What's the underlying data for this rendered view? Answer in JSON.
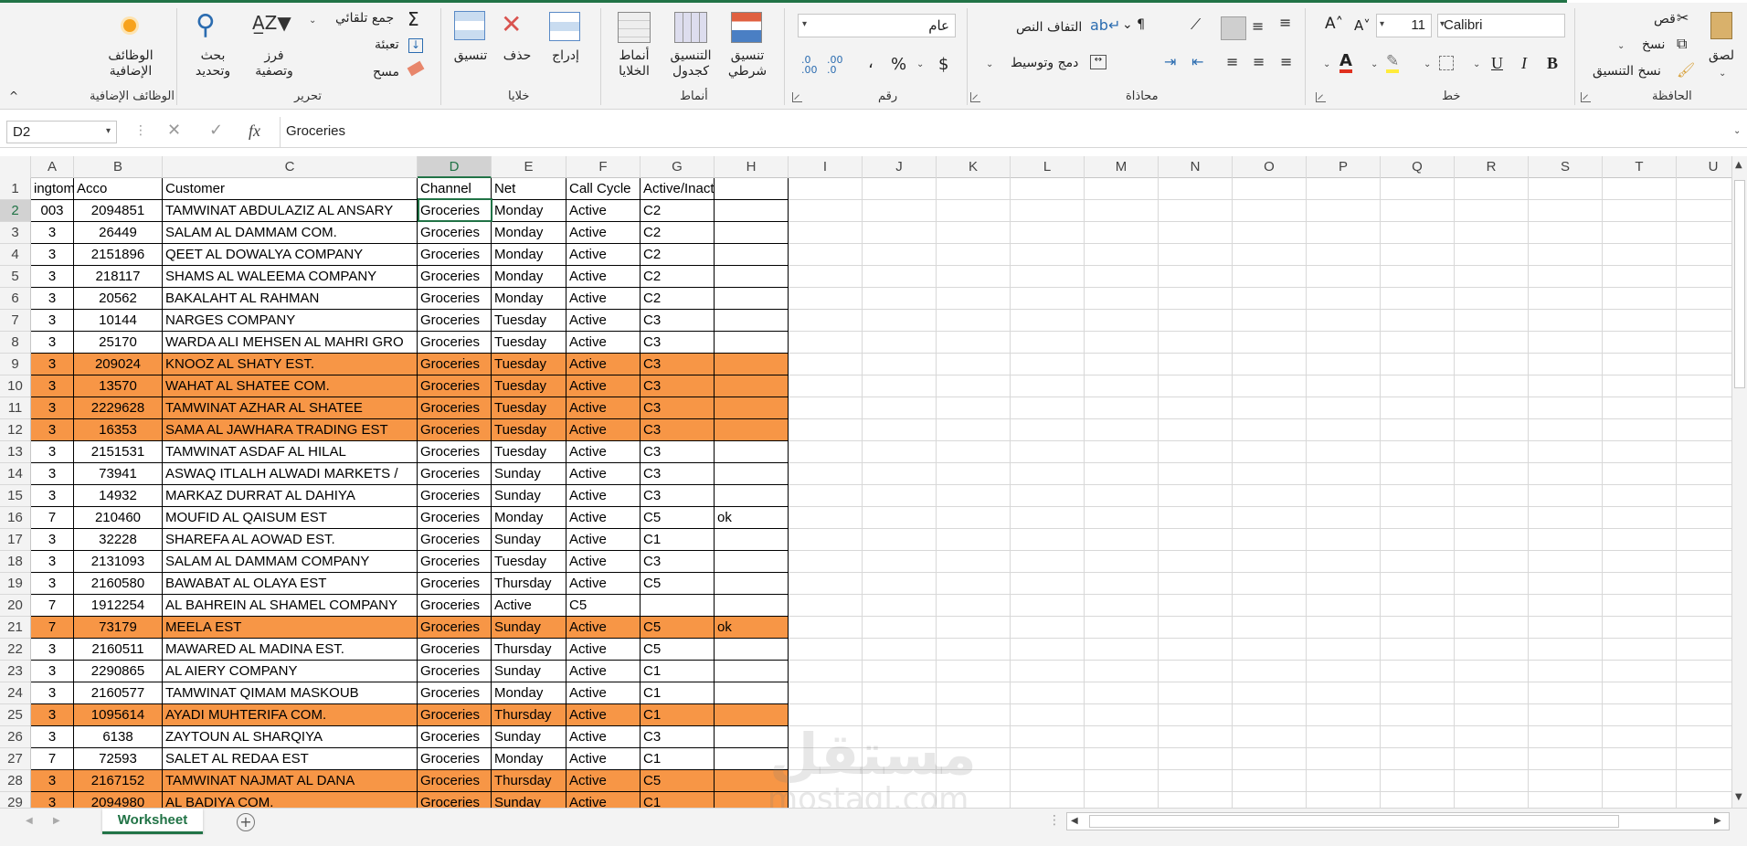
{
  "ribbon": {
    "addins": {
      "label": "الوظائف الإضافية",
      "group": "الوظائف الإضافية"
    },
    "editing": {
      "group": "تحرير",
      "autosum": "جمع تلقائي",
      "fill": "تعبئة",
      "clear": "مسح",
      "sort_filter": "فرز وتصفية",
      "find_select": "بحث وتحديد"
    },
    "cells": {
      "group": "خلايا",
      "format": "تنسيق",
      "delete": "حذف",
      "insert": "إدراج"
    },
    "styles": {
      "group": "أنماط",
      "cell_styles": "أنماط الخلايا",
      "format_table": "التنسيق كجدول",
      "conditional": "تنسيق شرطي"
    },
    "number": {
      "group": "رقم",
      "format_value": "عام",
      "currency": "$",
      "percent": "%",
      "comma": "،",
      "inc_dec": ".00 .0",
      "dec_dec": ".0 .00"
    },
    "alignment": {
      "group": "محاذاة",
      "wrap_text": "التفاف النص",
      "merge_center": "دمج وتوسيط"
    },
    "font": {
      "group": "خط",
      "name": "Calibri",
      "size": "11",
      "bold": "B",
      "italic": "I",
      "underline": "U"
    },
    "clipboard": {
      "group": "الحافظة",
      "paste": "لصق",
      "cut": "قص",
      "copy": "نسخ",
      "format_painter": "نسخ التنسيق"
    }
  },
  "formula_bar": {
    "name_box": "D2",
    "cancel": "✕",
    "enter": "✓",
    "fx": "fx",
    "formula": "Groceries"
  },
  "columns": [
    "A",
    "B",
    "C",
    "D",
    "E",
    "F",
    "G",
    "H",
    "I",
    "J",
    "K",
    "L",
    "M",
    "N",
    "O",
    "P",
    "Q",
    "R",
    "S",
    "T",
    "U"
  ],
  "header_row": {
    "A": "ingtom",
    "B": "Acco",
    "C": "Customer",
    "D": "Channel",
    "E": "Net",
    "F": "Call Cycle",
    "G": "Active/Inactive",
    "H": ""
  },
  "rows": [
    {
      "n": "2",
      "a": "003",
      "b": "2094851",
      "c": "TAMWINAT ABDULAZIZ AL ANSARY",
      "d": "Groceries",
      "e": "Monday",
      "f": "Active",
      "g": "C2",
      "h": "",
      "hl": false
    },
    {
      "n": "3",
      "a": "3",
      "b": "26449",
      "c": "SALAM AL DAMMAM COM.",
      "d": "Groceries",
      "e": "Monday",
      "f": "Active",
      "g": "C2",
      "h": "",
      "hl": false
    },
    {
      "n": "4",
      "a": "3",
      "b": "2151896",
      "c": "QEET AL DOWALYA COMPANY",
      "d": "Groceries",
      "e": "Monday",
      "f": "Active",
      "g": "C2",
      "h": "",
      "hl": false
    },
    {
      "n": "5",
      "a": "3",
      "b": "218117",
      "c": "SHAMS AL WALEEMA COMPANY",
      "d": "Groceries",
      "e": "Monday",
      "f": "Active",
      "g": "C2",
      "h": "",
      "hl": false
    },
    {
      "n": "6",
      "a": "3",
      "b": "20562",
      "c": "BAKALAHT AL RAHMAN",
      "d": "Groceries",
      "e": "Monday",
      "f": "Active",
      "g": "C2",
      "h": "",
      "hl": false
    },
    {
      "n": "7",
      "a": "3",
      "b": "10144",
      "c": "NARGES COMPANY",
      "d": "Groceries",
      "e": "Tuesday",
      "f": "Active",
      "g": "C3",
      "h": "",
      "hl": false
    },
    {
      "n": "8",
      "a": "3",
      "b": "25170",
      "c": "WARDA ALI MEHSEN AL MAHRI GRO",
      "d": "Groceries",
      "e": "Tuesday",
      "f": "Active",
      "g": "C3",
      "h": "",
      "hl": false
    },
    {
      "n": "9",
      "a": "3",
      "b": "209024",
      "c": "KNOOZ AL SHATY EST.",
      "d": "Groceries",
      "e": "Tuesday",
      "f": "Active",
      "g": "C3",
      "h": "",
      "hl": true
    },
    {
      "n": "10",
      "a": "3",
      "b": "13570",
      "c": "WAHAT AL SHATEE COM.",
      "d": "Groceries",
      "e": "Tuesday",
      "f": "Active",
      "g": "C3",
      "h": "",
      "hl": true
    },
    {
      "n": "11",
      "a": "3",
      "b": "2229628",
      "c": "TAMWINAT AZHAR AL SHATEE",
      "d": "Groceries",
      "e": "Tuesday",
      "f": "Active",
      "g": "C3",
      "h": "",
      "hl": true
    },
    {
      "n": "12",
      "a": "3",
      "b": "16353",
      "c": "SAMA AL JAWHARA TRADING EST",
      "d": "Groceries",
      "e": "Tuesday",
      "f": "Active",
      "g": "C3",
      "h": "",
      "hl": true
    },
    {
      "n": "13",
      "a": "3",
      "b": "2151531",
      "c": "TAMWINAT ASDAF AL HILAL",
      "d": "Groceries",
      "e": "Tuesday",
      "f": "Active",
      "g": "C3",
      "h": "",
      "hl": false
    },
    {
      "n": "14",
      "a": "3",
      "b": "73941",
      "c": "ASWAQ ITLALH ALWADI MARKETS /",
      "d": "Groceries",
      "e": "Sunday",
      "f": "Active",
      "g": "C3",
      "h": "",
      "hl": false
    },
    {
      "n": "15",
      "a": "3",
      "b": "14932",
      "c": "MARKAZ DURRAT AL DAHIYA",
      "d": "Groceries",
      "e": "Sunday",
      "f": "Active",
      "g": "C3",
      "h": "",
      "hl": false
    },
    {
      "n": "16",
      "a": "7",
      "b": "210460",
      "c": "MOUFID AL QAISUM EST",
      "d": "Groceries",
      "e": "Monday",
      "f": "Active",
      "g": "C5",
      "h": "ok",
      "hl": false
    },
    {
      "n": "17",
      "a": "3",
      "b": "32228",
      "c": "SHAREFA AL AOWAD EST.",
      "d": "Groceries",
      "e": "Sunday",
      "f": "Active",
      "g": "C1",
      "h": "",
      "hl": false
    },
    {
      "n": "18",
      "a": "3",
      "b": "2131093",
      "c": "SALAM AL DAMMAM COMPANY",
      "d": "Groceries",
      "e": "Tuesday",
      "f": "Active",
      "g": "C3",
      "h": "",
      "hl": false
    },
    {
      "n": "19",
      "a": "3",
      "b": "2160580",
      "c": "BAWABAT AL OLAYA EST",
      "d": "Groceries",
      "e": "Thursday",
      "f": "Active",
      "g": "C5",
      "h": "",
      "hl": false
    },
    {
      "n": "20",
      "a": "7",
      "b": "1912254",
      "c": "AL BAHREIN AL SHAMEL COMPANY",
      "d": "Groceries",
      "e": "Active",
      "f": "C5",
      "g": "",
      "h": "",
      "hl": false
    },
    {
      "n": "21",
      "a": "7",
      "b": "73179",
      "c": "MEELA EST",
      "d": "Groceries",
      "e": "Sunday",
      "f": "Active",
      "g": "C5",
      "h": "ok",
      "hl": true
    },
    {
      "n": "22",
      "a": "3",
      "b": "2160511",
      "c": "MAWARED AL MADINA EST.",
      "d": "Groceries",
      "e": "Thursday",
      "f": "Active",
      "g": "C5",
      "h": "",
      "hl": false
    },
    {
      "n": "23",
      "a": "3",
      "b": "2290865",
      "c": "AL AIERY COMPANY",
      "d": "Groceries",
      "e": "Sunday",
      "f": "Active",
      "g": "C1",
      "h": "",
      "hl": false
    },
    {
      "n": "24",
      "a": "3",
      "b": "2160577",
      "c": "TAMWINAT QIMAM MASKOUB",
      "d": "Groceries",
      "e": "Monday",
      "f": "Active",
      "g": "C1",
      "h": "",
      "hl": false
    },
    {
      "n": "25",
      "a": "3",
      "b": "1095614",
      "c": "AYADI MUHTERIFA COM.",
      "d": "Groceries",
      "e": "Thursday",
      "f": "Active",
      "g": "C1",
      "h": "",
      "hl": true
    },
    {
      "n": "26",
      "a": "3",
      "b": "6138",
      "c": "ZAYTOUN AL SHARQIYA",
      "d": "Groceries",
      "e": "Sunday",
      "f": "Active",
      "g": "C3",
      "h": "",
      "hl": false
    },
    {
      "n": "27",
      "a": "7",
      "b": "72593",
      "c": "SALET AL REDAA EST",
      "d": "Groceries",
      "e": "Monday",
      "f": "Active",
      "g": "C1",
      "h": "",
      "hl": false
    },
    {
      "n": "28",
      "a": "3",
      "b": "2167152",
      "c": "TAMWINAT NAJMAT AL DANA",
      "d": "Groceries",
      "e": "Thursday",
      "f": "Active",
      "g": "C5",
      "h": "",
      "hl": true
    },
    {
      "n": "29",
      "a": "3",
      "b": "2094980",
      "c": "AL BADIYA COM.",
      "d": "Groceries",
      "e": "Sunday",
      "f": "Active",
      "g": "C1",
      "h": "",
      "hl": true
    }
  ],
  "sheet_tab": "Worksheet",
  "watermark": {
    "arabic": "مستقل",
    "latin": "mostaql.com"
  },
  "colors": {
    "accent": "#217346",
    "highlight": "#f79646"
  }
}
